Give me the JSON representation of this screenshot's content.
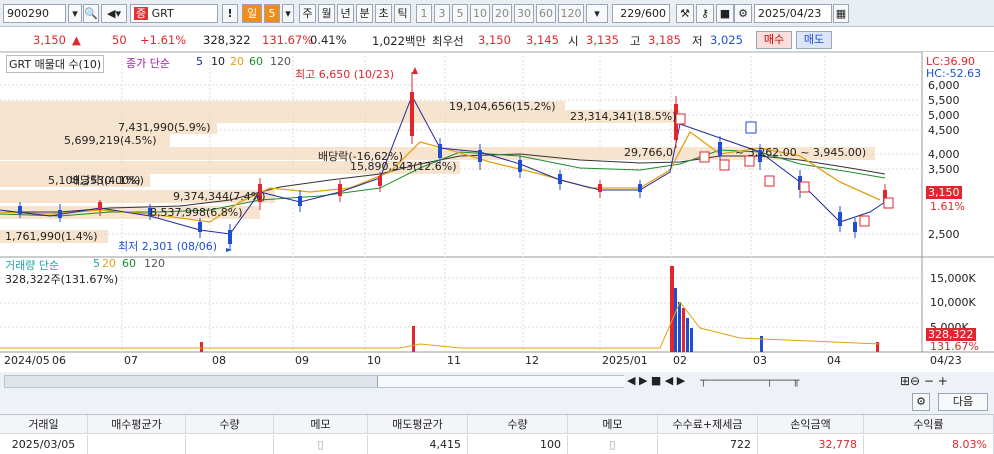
{
  "toolbar": {
    "code": "900290",
    "name": "GRT",
    "period_active": "일",
    "period_num": "5",
    "periods": [
      "주",
      "월",
      "년",
      "분",
      "초",
      "틱"
    ],
    "intervals": [
      "1",
      "3",
      "5",
      "10",
      "20",
      "30",
      "60",
      "120"
    ],
    "count": "229/600",
    "date": "2025/04/23"
  },
  "quote": {
    "price": "3,150",
    "arrow": "▲",
    "change": "50",
    "change_pct": "+1.61%",
    "volume": "328,322",
    "vol_ratio": "131.67%",
    "turnover_pct": "0.41%",
    "amount": "1,022백만",
    "pref": "최우선",
    "ask": "3,150",
    "bid": "3,145",
    "open_label": "시",
    "open": "3,135",
    "high_label": "고",
    "high": "3,185",
    "low_label": "저",
    "low": "3,025",
    "buy": "매수",
    "sell": "매도"
  },
  "chart": {
    "legend_title": "GRT 매물대 수(10)",
    "ma_label": "종가 단순",
    "ma_periods": [
      "5",
      "10",
      "20",
      "60",
      "120"
    ],
    "lc": "LC:36.90",
    "hc": "HC:-52.63",
    "high_note": "최고 6,650 (10/23)",
    "low_note": "최저 2,301 (08/06)",
    "div_note1": "배당락(-16,62%)",
    "div_note2": "배당락(0.00%)",
    "price_ticks": [
      "6,000",
      "5,500",
      "5,000",
      "4,500",
      "4,000",
      "3,500",
      "2,500"
    ],
    "last_price": "3,150",
    "last_pct": "1.61%",
    "profile": [
      {
        "text": "19,104,656(15.2%)"
      },
      {
        "text": "23,314,341(18.5%)"
      },
      {
        "text": "7,431,990(5.9%)"
      },
      {
        "text": "5,699,219(4.5%)"
      },
      {
        "text": "29,766,0"
      },
      {
        "text": "~ 3,262.00 ~ 3,945.00)"
      },
      {
        "text": "15,890,543(12.6%)"
      },
      {
        "text": "5,108,353(4.1%)"
      },
      {
        "text": "9,374,344(7.4%)"
      },
      {
        "text": "8,537,998(6.8%)"
      },
      {
        "text": "1,761,990(1.4%)"
      }
    ],
    "vol_label": "거래량 단순",
    "vol_periods": [
      "5",
      "20",
      "60",
      "120"
    ],
    "vol_value": "328,322주(131.67%)",
    "vol_ticks": [
      "15,000K",
      "10,000K",
      "5,000K"
    ],
    "vol_last": "328,322",
    "vol_last_pct": "131.67%",
    "x_labels": [
      "2024/05",
      "06",
      "07",
      "08",
      "09",
      "10",
      "11",
      "12",
      "2025/01",
      "02",
      "03",
      "04"
    ],
    "x_right": "04/23"
  },
  "table": {
    "headers": [
      "거래일",
      "매수평균가",
      "수량",
      "메모",
      "매도평균가",
      "수량",
      "메모",
      "수수료+제세금",
      "손익금액",
      "수익률"
    ],
    "row": [
      "2025/03/05",
      "",
      "",
      "",
      "4,415",
      "100",
      "",
      "722",
      "32,778",
      "8.03%"
    ],
    "next": "다음"
  }
}
